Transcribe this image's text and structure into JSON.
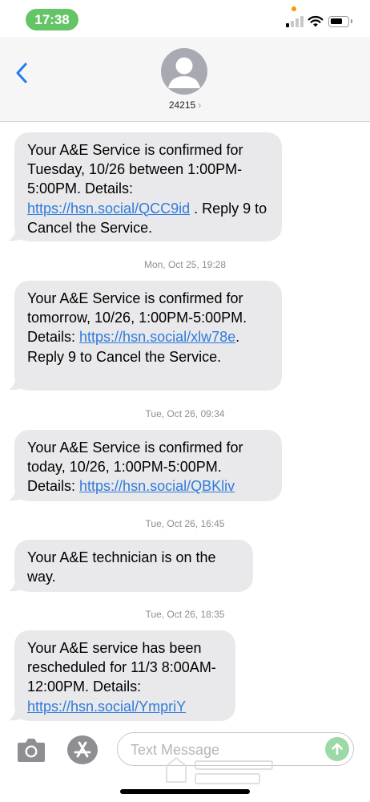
{
  "status_bar": {
    "time": "17:38",
    "icons": [
      "signal-icon",
      "wifi-icon",
      "battery-icon"
    ],
    "pill_color": "#65c466"
  },
  "header": {
    "contact": "24215",
    "chevron": "›",
    "icons": [
      "back-chevron-icon",
      "person-avatar-icon"
    ]
  },
  "conversation": {
    "messages": [
      {
        "parts": [
          "Your A&E Service is confirmed for Tuesday, 10/26 between 1:00PM-5:00PM. Details: ",
          "https://hsn.social/QCC9id",
          " . Reply 9 to Cancel the Service."
        ]
      },
      {
        "timestamp_day": "Mon, Oct 25,",
        "timestamp_time": "19:28",
        "parts": [
          "Your A&E Service is confirmed for tomorrow, 10/26, 1:00PM-5:00PM. Details: ",
          "https://hsn.social/xlw78e",
          ". Reply 9 to Cancel the Service."
        ]
      },
      {
        "timestamp_day": "Tue, Oct 26,",
        "timestamp_time": "09:34",
        "parts": [
          "Your A&E Service is confirmed for today, 10/26, 1:00PM-5:00PM. Details: ",
          "https://hsn.social/QBKliv",
          ""
        ]
      },
      {
        "timestamp_day": "Tue, Oct 26,",
        "timestamp_time": "16:45",
        "parts": [
          "Your A&E technician is on the way.",
          "",
          ""
        ]
      },
      {
        "timestamp_day": "Tue, Oct 26,",
        "timestamp_time": "18:35",
        "parts": [
          "Your A&E service has been rescheduled for 11/3 8:00AM-12:00PM. Details: ",
          "https://hsn.social/YmpriY",
          ""
        ]
      }
    ],
    "bubble_color": "#e9e9eb",
    "link_color": "#2f7bdc"
  },
  "input_bar": {
    "placeholder": "Text Message",
    "icons": [
      "camera-icon",
      "app-store-icon",
      "send-arrow-icon"
    ],
    "send_color": "#9bd9a6"
  }
}
